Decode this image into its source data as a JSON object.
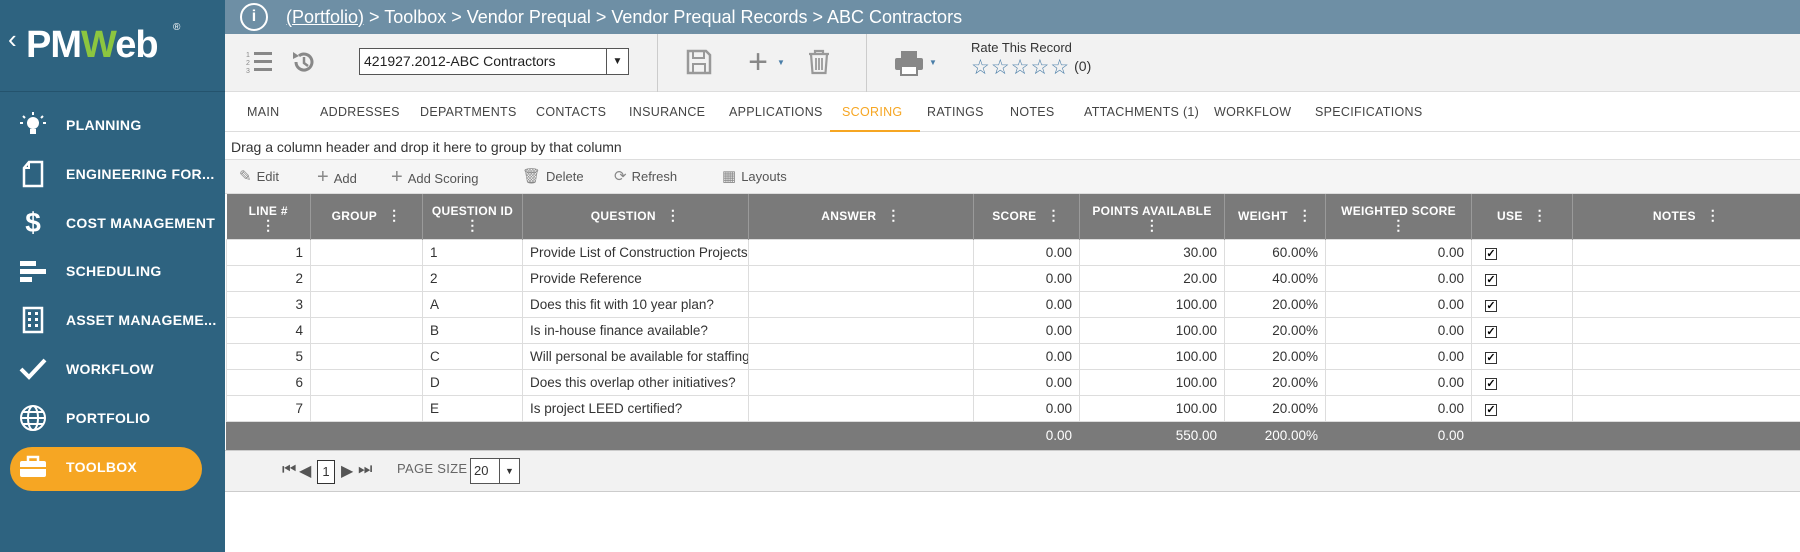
{
  "app": {
    "logo_prefix": "PM",
    "logo_w": "W",
    "logo_suffix": "eb",
    "logo_reg": "®"
  },
  "sidebar": {
    "items": [
      {
        "label": "PLANNING",
        "icon": "lightbulb-icon"
      },
      {
        "label": "ENGINEERING FOR...",
        "icon": "document-icon"
      },
      {
        "label": "COST MANAGEMENT",
        "icon": "dollar-icon"
      },
      {
        "label": "SCHEDULING",
        "icon": "gantt-icon"
      },
      {
        "label": "ASSET MANAGEME...",
        "icon": "building-icon"
      },
      {
        "label": "WORKFLOW",
        "icon": "checkmark-icon"
      },
      {
        "label": "PORTFOLIO",
        "icon": "globe-icon"
      },
      {
        "label": "TOOLBOX",
        "icon": "briefcase-icon"
      }
    ],
    "active": "TOOLBOX"
  },
  "breadcrumb": {
    "link": "(Portfolio)",
    "rest": " > Toolbox > Vendor Prequal > Vendor Prequal Records > ABC Contractors"
  },
  "toolbar": {
    "record": "421927.2012-ABC Contractors",
    "rate_label": "Rate This Record",
    "stars": "☆☆☆☆☆",
    "rate_count": "(0)"
  },
  "tabs": [
    "MAIN",
    "ADDRESSES",
    "DEPARTMENTS",
    "CONTACTS",
    "INSURANCE",
    "APPLICATIONS",
    "SCORING",
    "RATINGS",
    "NOTES",
    "ATTACHMENTS (1)",
    "WORKFLOW",
    "SPECIFICATIONS"
  ],
  "active_tab": "SCORING",
  "group_hint": "Drag a column header and drop it here to group by that column",
  "grid_toolbar": {
    "edit": "Edit",
    "add": "Add",
    "add_scoring": "Add Scoring",
    "delete": "Delete",
    "refresh": "Refresh",
    "layouts": "Layouts"
  },
  "columns": [
    "LINE #",
    "GROUP",
    "QUESTION ID",
    "QUESTION",
    "ANSWER",
    "SCORE",
    "POINTS AVAILABLE",
    "WEIGHT",
    "WEIGHTED SCORE",
    "USE",
    "NOTES"
  ],
  "rows": [
    {
      "line": "1",
      "group": "",
      "qid": "1",
      "question": "Provide List of Construction Projects",
      "answer": "",
      "score": "0.00",
      "points": "30.00",
      "weight": "60.00%",
      "wscore": "0.00",
      "use": "✓",
      "notes": ""
    },
    {
      "line": "2",
      "group": "",
      "qid": "2",
      "question": "Provide Reference",
      "answer": "",
      "score": "0.00",
      "points": "20.00",
      "weight": "40.00%",
      "wscore": "0.00",
      "use": "✓",
      "notes": ""
    },
    {
      "line": "3",
      "group": "",
      "qid": "A",
      "question": "Does this fit with 10 year plan?",
      "answer": "",
      "score": "0.00",
      "points": "100.00",
      "weight": "20.00%",
      "wscore": "0.00",
      "use": "✓",
      "notes": ""
    },
    {
      "line": "4",
      "group": "",
      "qid": "B",
      "question": "Is in-house finance available?",
      "answer": "",
      "score": "0.00",
      "points": "100.00",
      "weight": "20.00%",
      "wscore": "0.00",
      "use": "✓",
      "notes": ""
    },
    {
      "line": "5",
      "group": "",
      "qid": "C",
      "question": "Will personal be available for staffing?",
      "answer": "",
      "score": "0.00",
      "points": "100.00",
      "weight": "20.00%",
      "wscore": "0.00",
      "use": "✓",
      "notes": ""
    },
    {
      "line": "6",
      "group": "",
      "qid": "D",
      "question": "Does this overlap other initiatives?",
      "answer": "",
      "score": "0.00",
      "points": "100.00",
      "weight": "20.00%",
      "wscore": "0.00",
      "use": "✓",
      "notes": ""
    },
    {
      "line": "7",
      "group": "",
      "qid": "E",
      "question": "Is project LEED certified?",
      "answer": "",
      "score": "0.00",
      "points": "100.00",
      "weight": "20.00%",
      "wscore": "0.00",
      "use": "✓",
      "notes": ""
    }
  ],
  "totals": {
    "score": "0.00",
    "points": "550.00",
    "weight": "200.00%",
    "wscore": "0.00"
  },
  "pager": {
    "page": "1",
    "page_size_label": "PAGE SIZE",
    "page_size": "20"
  }
}
